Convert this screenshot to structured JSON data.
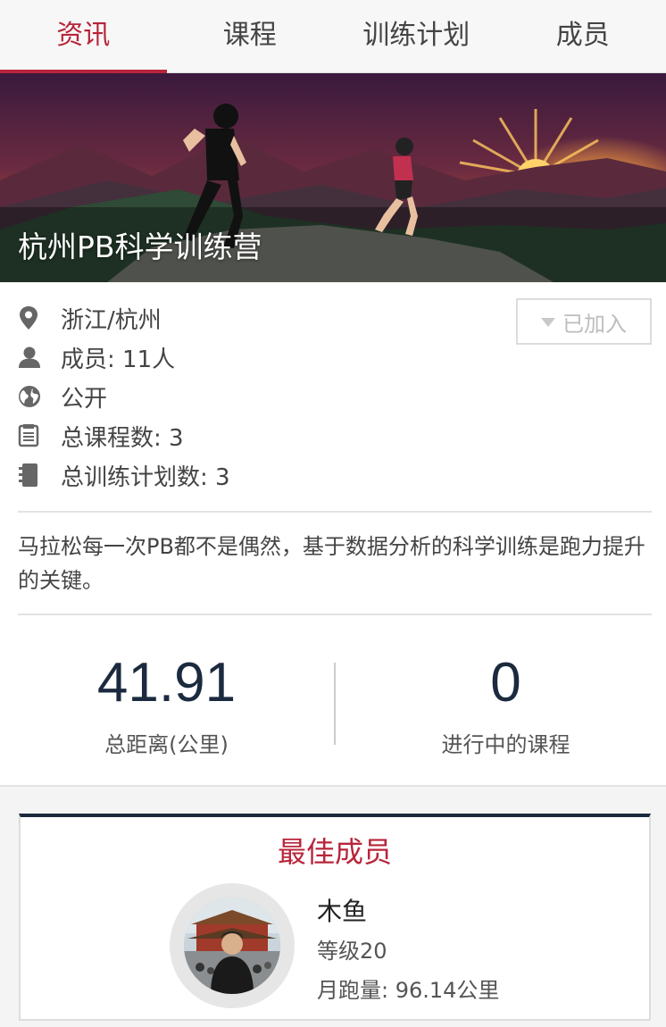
{
  "tabs": [
    {
      "label": "资讯",
      "active": true
    },
    {
      "label": "课程",
      "active": false
    },
    {
      "label": "训练计划",
      "active": false
    },
    {
      "label": "成员",
      "active": false
    }
  ],
  "banner": {
    "title": "杭州PB科学训练营"
  },
  "info": {
    "location": "浙江/杭州",
    "members": "成员: 11人",
    "visibility": "公开",
    "courses": "总课程数: 3",
    "plans": "总训练计划数: 3"
  },
  "join_button": {
    "label": "已加入"
  },
  "description": "马拉松每一次PB都不是偶然，基于数据分析的科学训练是跑力提升的关键。",
  "stats": [
    {
      "value": "41.91",
      "label": "总距离(公里)"
    },
    {
      "value": "0",
      "label": "进行中的课程"
    }
  ],
  "best_member": {
    "title": "最佳成员",
    "name": "木鱼",
    "level": "等级20",
    "monthly_distance": "月跑量: 96.14公里"
  },
  "colors": {
    "accent": "#b8253a",
    "dark": "#1b2a3e"
  },
  "icons": [
    "location-pin-icon",
    "person-icon",
    "globe-icon",
    "course-list-icon",
    "notebook-icon",
    "caret-down-icon"
  ]
}
